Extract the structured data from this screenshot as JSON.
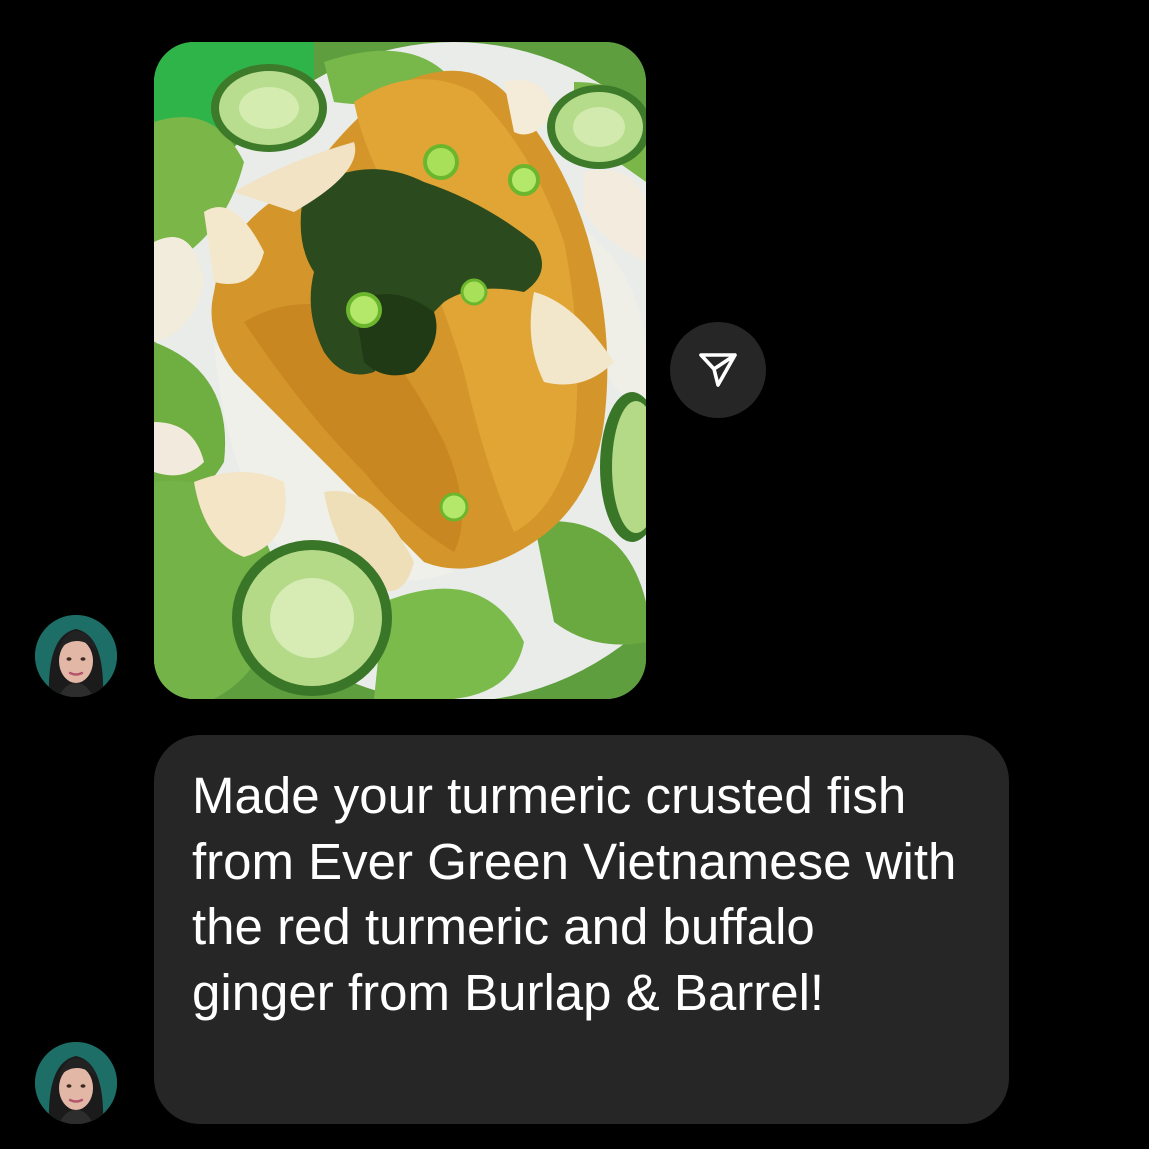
{
  "conversation": {
    "messages": [
      {
        "type": "photo",
        "alt": "turmeric crusted fish on lettuce with cucumbers and rice noodles"
      },
      {
        "type": "text",
        "text": "Made your turmeric crusted fish from Ever Green Vietnamese with the red turmeric and buffalo ginger from Burlap & Barrel!"
      }
    ],
    "share_icon": "paper-plane-icon",
    "avatar_icon": "user-avatar"
  },
  "colors": {
    "background": "#000000",
    "bubble": "#262626",
    "text": "#ffffff"
  }
}
